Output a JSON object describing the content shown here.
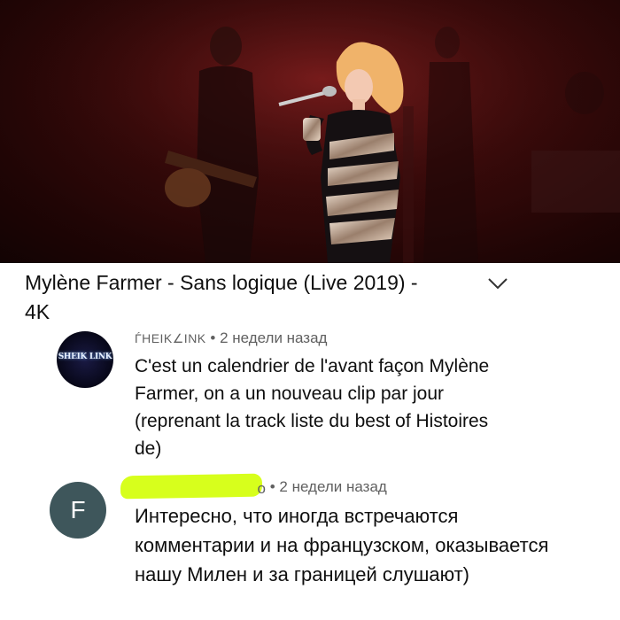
{
  "video": {
    "title": "Mylène Farmer - Sans logique (Live 2019) - 4K"
  },
  "comments": [
    {
      "avatar_text": "SHEIK LINK",
      "username": "ЃHEIK∠INK",
      "separator": " • ",
      "time": "2 недели назад",
      "text": "C'est un calendrier de l'avant façon Mylène Farmer, on a un nouveau clip par jour (reprenant la track liste du best of Histoires de)"
    },
    {
      "avatar_letter": "F",
      "username_tail": "о",
      "separator": " • ",
      "time": "2 недели назад",
      "text": "Интересно, что иногда встречаются комментарии и на французском, оказывается нашу Милен и за границей слушают)"
    }
  ],
  "colors": {
    "highlight": "#d7ff1c",
    "avatar_f": "#3e565b",
    "meta_text": "#606060"
  }
}
